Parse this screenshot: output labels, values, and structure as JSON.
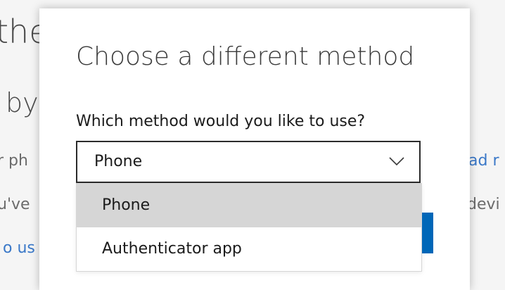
{
  "background": {
    "heading_fragment_1": "the",
    "heading_fragment_2": "by",
    "text_fragment_1": "r ph",
    "text_fragment_2": "u've",
    "link_fragment_left": "o us",
    "link_fragment_right": "ad r",
    "text_fragment_right": "devi"
  },
  "dialog": {
    "title": "Choose a different method",
    "method_label": "Which method would you like to use?",
    "select": {
      "selected_value": "Phone",
      "icon": "chevron-down-icon"
    },
    "options": [
      {
        "label": "Phone",
        "selected": true
      },
      {
        "label": "Authenticator app",
        "selected": false
      }
    ]
  },
  "colors": {
    "primary_button": "#0067b8",
    "selected_option": "#d6d6d6",
    "link": "#3a78c8"
  }
}
